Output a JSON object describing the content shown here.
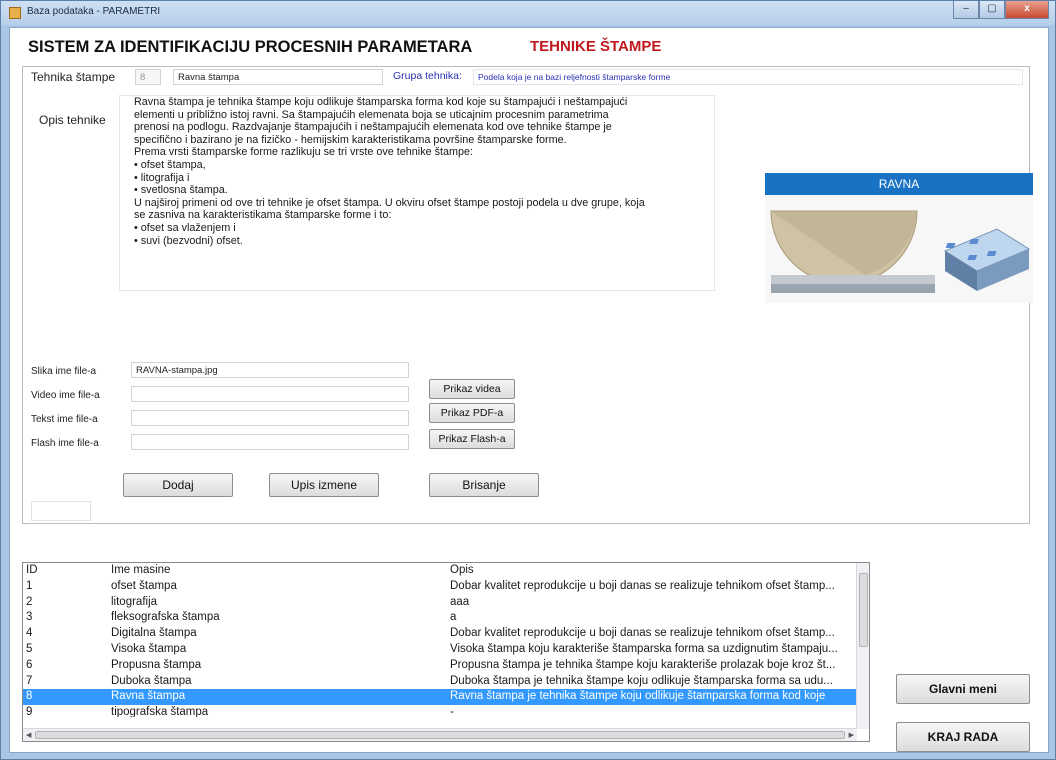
{
  "window": {
    "title": "Baza podataka - PARAMETRI",
    "controls": {
      "minimize": "–",
      "maximize": "▢",
      "close": "x"
    }
  },
  "header": {
    "title": "SISTEM ZA IDENTIFIKACIJU PROCESNIH PARAMETARA",
    "subtitle": "TEHNIKE ŠTAMPE"
  },
  "form": {
    "tehnika_label": "Tehnika štampe",
    "tehnika_id": "8",
    "tehnika_name": "Ravna štampa",
    "grupa_label": "Grupa tehnika:",
    "grupa_value": "Podela koja je na bazi reljefnosti štamparske forme",
    "opis_label": "Opis tehnike",
    "opis_lines": [
      "Ravna štampa je tehnika štampe koju odlikuje štamparska forma kod koje su štampajući i neštampajući",
      "elementi u približno istoj ravni. Sa štampajućih elemenata boja se uticajnim procesnim parametrima",
      "prenosi na podlogu. Razdvajanje štampajućih i neštampajućih elemenata kod ove tehnike štampe je",
      "specifično i bazirano je na fizičko - hemijskim karakteristikama površine štamparske forme.",
      "Prema vrsti štamparske forme razlikuju se tri vrste ove tehnike štampe:",
      "• ofset štampa,",
      "• litografija i",
      "• svetlosna štampa.",
      "U najširoj primeni od ove tri tehnike je ofset štampa. U okviru ofset štampe postoji podela u dve grupe, koja",
      "se zasniva na karakteristikama štamparske forme i to:",
      "• ofset sa vlaženjem i",
      "• suvi (bezvodni) ofset."
    ],
    "image_caption": "RAVNA",
    "slika_label": "Slika ime file-a",
    "slika_value": "RAVNA-stampa.jpg",
    "video_label": "Video ime file-a",
    "video_value": "",
    "tekst_label": "Tekst ime file-a",
    "tekst_value": "",
    "flash_label": "Flash ime file-a",
    "flash_value": "",
    "btn_video": "Prikaz videa",
    "btn_pdf": "Prikaz PDF-a",
    "btn_flash": "Prikaz Flash-a",
    "btn_dodaj": "Dodaj",
    "btn_upis": "Upis izmene",
    "btn_brisanje": "Brisanje"
  },
  "table": {
    "headers": [
      "ID",
      "Ime masine",
      "Opis"
    ],
    "rows": [
      {
        "id": "1",
        "ime": "ofset štampa",
        "opis": "Dobar kvalitet reprodukcije u boji danas se realizuje tehnikom ofset štamp..."
      },
      {
        "id": "2",
        "ime": "litografija",
        "opis": "aaa"
      },
      {
        "id": "3",
        "ime": "fleksografska štampa",
        "opis": "a"
      },
      {
        "id": "4",
        "ime": "Digitalna štampa",
        "opis": "Dobar kvalitet reprodukcije u boji danas se realizuje tehnikom ofset štamp..."
      },
      {
        "id": "5",
        "ime": "Visoka štampa",
        "opis": "Visoka štampa koju karakteriše štamparska forma sa uzdignutim štampaju..."
      },
      {
        "id": "6",
        "ime": "Propusna štampa",
        "opis": "Propusna štampa je tehnika štampe koju karakteriše prolazak boje kroz št..."
      },
      {
        "id": "7",
        "ime": "Duboka štampa",
        "opis": "Duboka štampa je tehnika štampe koju odlikuje štamparska forma sa udu..."
      },
      {
        "id": "8",
        "ime": "Ravna štampa",
        "opis": "Ravna štampa je tehnika štampe koju odlikuje štamparska forma kod koje"
      },
      {
        "id": "9",
        "ime": "tipografska štampa",
        "opis": "-"
      }
    ],
    "selected_index": 7
  },
  "side_buttons": {
    "glavni_meni": "Glavni meni",
    "kraj_rada": "KRAJ RADA"
  }
}
